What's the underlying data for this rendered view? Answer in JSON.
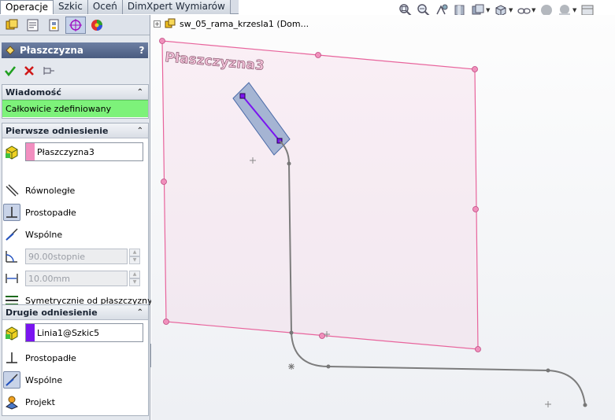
{
  "tabs": [
    {
      "label": "Operacje",
      "active": true
    },
    {
      "label": "Szkic",
      "active": false
    },
    {
      "label": "Oceń",
      "active": false
    },
    {
      "label": "DimXpert Wymiarów",
      "active": false
    }
  ],
  "property_manager": {
    "title": "Płaszczyzna",
    "help": "?"
  },
  "message_group": {
    "title": "Wiadomość",
    "text": "Całkowicie zdefiniowany"
  },
  "first_reference": {
    "title": "Pierwsze odniesienie",
    "selection": "Płaszczyzna3",
    "swatch_color": "#f28fc0",
    "options": {
      "parallel": "Równoległe",
      "perpendicular": "Prostopadłe",
      "coincident": "Wspólne",
      "symmetric": "Symetrycznie od płaszczyzny"
    },
    "angle_value": "90.00stopnie",
    "distance_value": "10.00mm"
  },
  "second_reference": {
    "title": "Drugie odniesienie",
    "selection": "Linia1@Szkic5",
    "swatch_color": "#7a14f0",
    "options": {
      "perpendicular": "Prostopadłe",
      "coincident": "Wspólne",
      "project": "Projekt"
    }
  },
  "tree": {
    "label": "sw_05_rama_krzesla1  (Dom...",
    "expand": "+"
  },
  "scene": {
    "plane_label": "Płaszczyzna3",
    "plane_color": "#e8649c"
  }
}
